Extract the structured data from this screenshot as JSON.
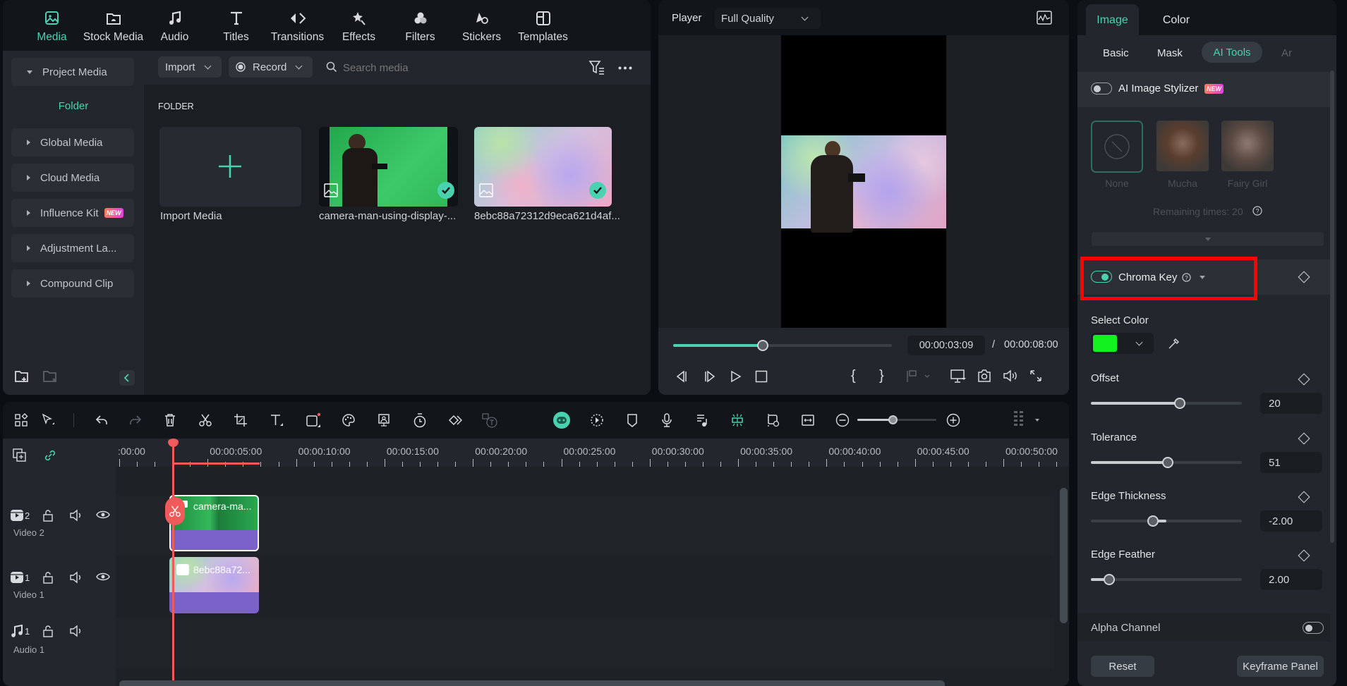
{
  "top_tabs": [
    {
      "label": "Media",
      "icon": "media-icon",
      "active": true
    },
    {
      "label": "Stock Media",
      "icon": "stock-media-icon"
    },
    {
      "label": "Audio",
      "icon": "music-note-icon"
    },
    {
      "label": "Titles",
      "icon": "titles-icon"
    },
    {
      "label": "Transitions",
      "icon": "transitions-icon"
    },
    {
      "label": "Effects",
      "icon": "effects-icon"
    },
    {
      "label": "Filters",
      "icon": "filters-icon"
    },
    {
      "label": "Stickers",
      "icon": "stickers-icon"
    },
    {
      "label": "Templates",
      "icon": "templates-icon"
    }
  ],
  "sidebar": {
    "items": [
      {
        "label": "Project Media",
        "expanded": true
      },
      {
        "label": "Global Media"
      },
      {
        "label": "Cloud Media"
      },
      {
        "label": "Influence Kit",
        "badge": "NEW"
      },
      {
        "label": "Adjustment La..."
      },
      {
        "label": "Compound Clip"
      }
    ],
    "folder_label": "Folder"
  },
  "media_toolbar": {
    "import_label": "Import",
    "record_label": "Record",
    "search_placeholder": "Search media"
  },
  "media_grid": {
    "section_title": "FOLDER",
    "items": [
      {
        "label": "Import Media",
        "type": "import"
      },
      {
        "label": "camera-man-using-display-...",
        "type": "image",
        "checked": true
      },
      {
        "label": "8ebc88a72312d9eca621d4af...",
        "type": "image",
        "checked": true
      }
    ]
  },
  "player": {
    "label": "Player",
    "quality": "Full Quality",
    "current_time": "00:00:03:09",
    "separator": "/",
    "total_time": "00:00:08:00",
    "progress": 0.41
  },
  "properties": {
    "tabs": [
      {
        "label": "Image",
        "active": true
      },
      {
        "label": "Color"
      }
    ],
    "subtabs": [
      {
        "label": "Basic"
      },
      {
        "label": "Mask"
      },
      {
        "label": "AI Tools",
        "active": true
      },
      {
        "label": "Ar"
      }
    ],
    "ai_stylizer": {
      "label": "AI Image Stylizer",
      "badge": "NEW",
      "enabled": false,
      "styles": [
        {
          "label": "None",
          "selected": true
        },
        {
          "label": "Mucha"
        },
        {
          "label": "Fairy Girl"
        }
      ],
      "remaining": "Remaining times: 20"
    },
    "chroma_key": {
      "label": "Chroma Key",
      "enabled": true,
      "select_color_label": "Select Color",
      "color": "#12f020",
      "sliders": [
        {
          "label": "Offset",
          "value": "20",
          "fraction": 0.59
        },
        {
          "label": "Tolerance",
          "value": "51",
          "fraction": 0.51
        },
        {
          "label": "Edge Thickness",
          "value": "-2.00",
          "fraction": 0.41,
          "center": 0.5
        },
        {
          "label": "Edge Feather",
          "value": "2.00",
          "fraction": 0.12
        }
      ],
      "alpha_channel_label": "Alpha Channel",
      "alpha_enabled": false
    },
    "reset_label": "Reset",
    "keyframe_label": "Keyframe Panel"
  },
  "timeline": {
    "ruler_labels": [
      ":00:00",
      "00:00:05:00",
      "00:00:10:00",
      "00:00:15:00",
      "00:00:20:00",
      "00:00:25:00",
      "00:00:30:00",
      "00:00:35:00",
      "00:00:40:00",
      "00:00:45:00",
      "00:00:50:00"
    ],
    "tracks": [
      {
        "name": "Video 2",
        "number": "2",
        "kind": "video",
        "clip": "camera-ma..."
      },
      {
        "name": "Video 1",
        "number": "1",
        "kind": "video",
        "clip": "8ebc88a72..."
      },
      {
        "name": "Audio 1",
        "number": "1",
        "kind": "audio"
      }
    ],
    "zoom_level": 0.45
  },
  "colors": {
    "accent": "#4ad1b0",
    "playhead": "#f05a5a",
    "clip_purple": "#7a62c9",
    "highlight_box": "#ff0000"
  }
}
